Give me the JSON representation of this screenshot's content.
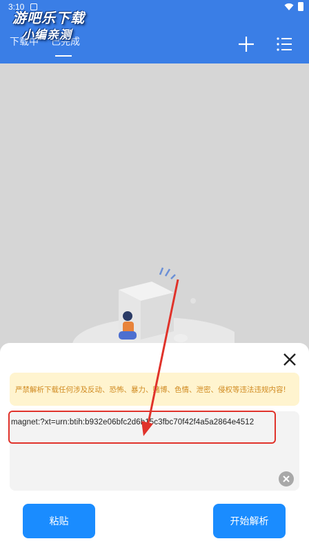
{
  "status_bar": {
    "time": "3:10"
  },
  "watermark": {
    "line1": "游吧乐下载",
    "line2": "小编亲测"
  },
  "tabs": [
    {
      "label": "下载中"
    },
    {
      "label": "已完成"
    }
  ],
  "header_icons": {
    "add": "plus-icon",
    "menu": "list-menu-icon"
  },
  "sheet": {
    "notice": "严禁解析下载任何涉及反动、恐怖、暴力、赌博、色情、泄密、侵权等违法违规内容!",
    "input_value": "magnet:?xt=urn:btih:b932e06bfc2d6b15c3fbc70f42f4a5a2864e4512",
    "paste_label": "粘贴",
    "start_label": "开始解析"
  },
  "colors": {
    "header": "#3a7ee6",
    "button": "#1a8cff",
    "notice_bg": "#fff4cf",
    "notice_text": "#d08a20",
    "annotation": "#e0322a"
  }
}
